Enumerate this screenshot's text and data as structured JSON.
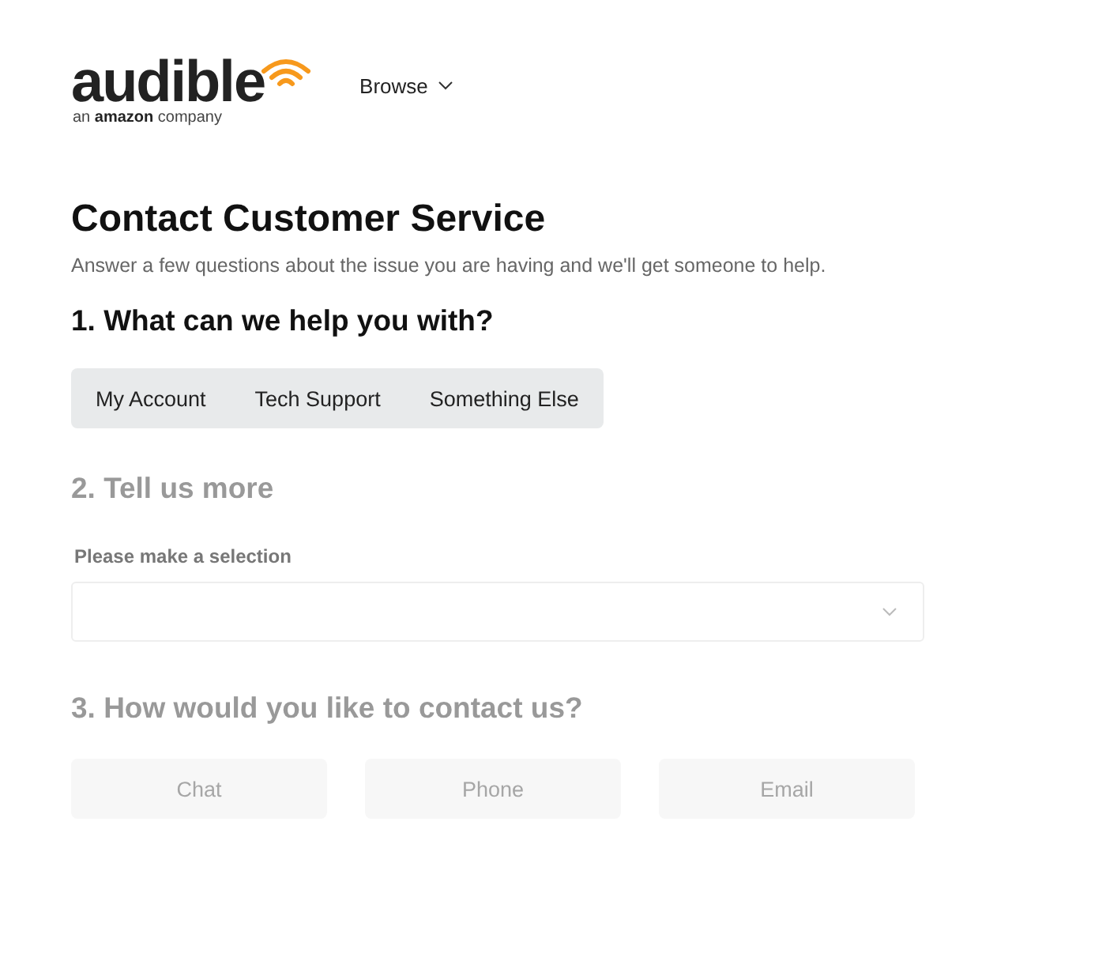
{
  "header": {
    "logo": {
      "wordmark": "audible",
      "tagline_pre": "an",
      "tagline_brand": "amazon",
      "tagline_post": "company"
    },
    "nav": [
      {
        "label": "Browse",
        "expanded": false
      }
    ]
  },
  "page": {
    "title": "Contact Customer Service",
    "subtitle": "Answer a few questions about the issue you are having and we'll get someone to help."
  },
  "steps": [
    {
      "kind": "options",
      "heading": "1. What can we help you with?",
      "disabled": false,
      "options": [
        {
          "label": "My Account",
          "selected": false
        },
        {
          "label": "Tech Support",
          "selected": false
        },
        {
          "label": "Something Else",
          "selected": false
        }
      ]
    },
    {
      "kind": "select",
      "heading": "2. Tell us more",
      "disabled": true,
      "label": "Please make a selection"
    },
    {
      "kind": "buttons",
      "heading": "3. How would you like to contact us?",
      "disabled": true,
      "buttons": [
        {
          "label": "Chat",
          "disabled": true
        },
        {
          "label": "Phone",
          "disabled": true
        },
        {
          "label": "Email",
          "disabled": true
        }
      ]
    }
  ]
}
